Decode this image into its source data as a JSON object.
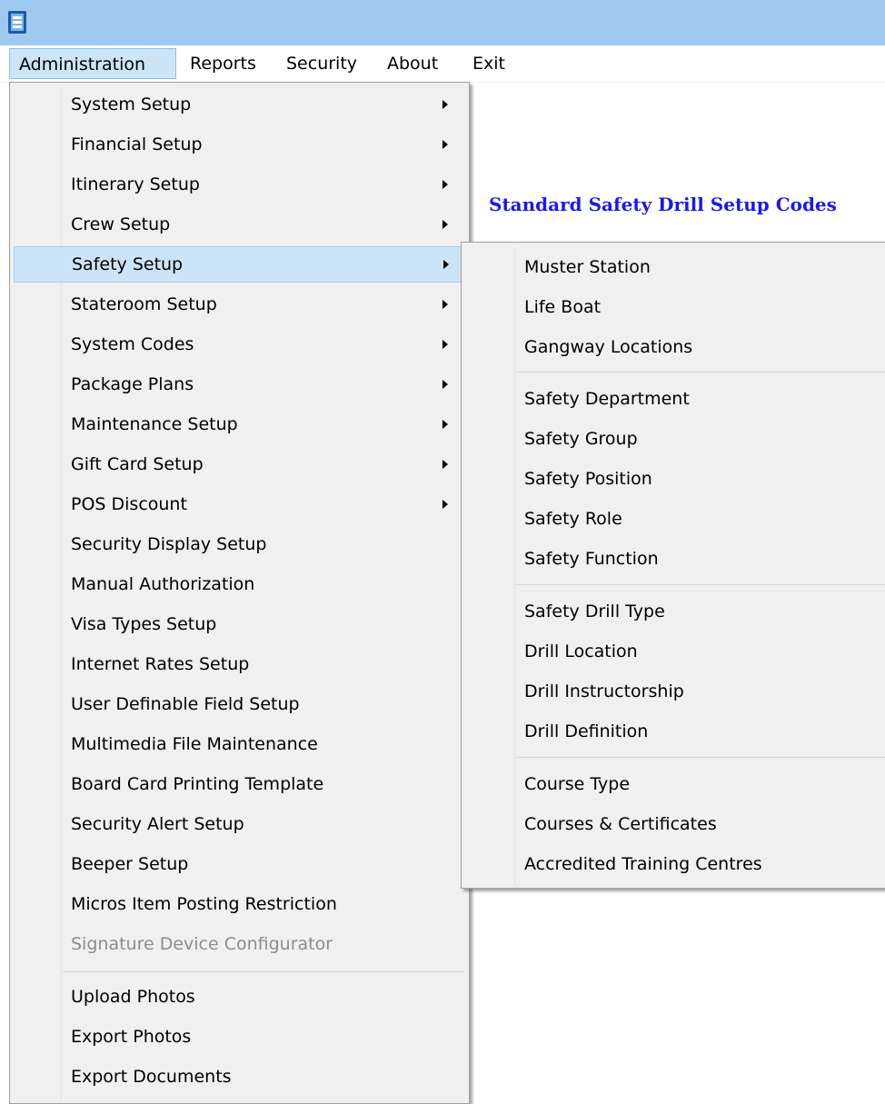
{
  "menubar": {
    "items": [
      "Administration",
      "Reports",
      "Security",
      "About",
      "Exit"
    ]
  },
  "page": {
    "heading": "Standard Safety Drill Setup Codes"
  },
  "admin_menu": {
    "items": [
      "System Setup",
      "Financial Setup",
      "Itinerary Setup",
      "Crew Setup",
      "Safety Setup",
      "Stateroom Setup",
      "System Codes",
      "Package Plans",
      "Maintenance Setup",
      "Gift Card Setup",
      "POS Discount",
      "Security Display Setup",
      "Manual Authorization",
      "Visa Types Setup",
      "Internet Rates Setup",
      "User Definable Field Setup",
      "Multimedia File Maintenance",
      "Board Card Printing Template",
      "Security Alert Setup",
      "Beeper Setup",
      "Micros Item Posting Restriction",
      "Signature Device Configurator",
      "Upload Photos",
      "Export Photos",
      "Export Documents"
    ]
  },
  "safety_menu": {
    "items": [
      "Muster Station",
      "Life Boat",
      "Gangway Locations",
      "Safety Department",
      "Safety Group",
      "Safety Position",
      "Safety Role",
      "Safety Function",
      "Safety Drill Type",
      "Drill Location",
      "Drill Instructorship",
      "Drill Definition",
      "Course Type",
      "Courses & Certificates",
      "Accredited Training Centres"
    ]
  },
  "colors": {
    "titlebar": "#9fcaef",
    "heading": "#1a1ae6",
    "highlight": "#cce4f7"
  }
}
